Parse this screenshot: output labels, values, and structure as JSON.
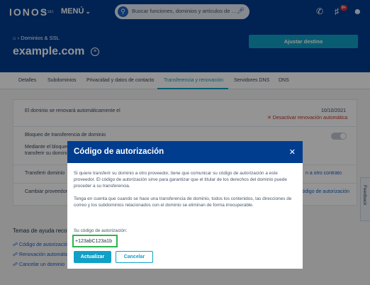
{
  "header": {
    "logo": "IONOS",
    "logo_by": "by 1&1",
    "menu_label": "MENÚ",
    "search_placeholder": "Buscar funciones, dominios y artículos de …",
    "notification_count": "9+"
  },
  "breadcrumb": {
    "section": "Dominios & SSL"
  },
  "domain": {
    "name": "example.com"
  },
  "actions": {
    "adjust_destination": "Ajustar destino"
  },
  "tabs": [
    {
      "label": "Detalles"
    },
    {
      "label": "Subdominios"
    },
    {
      "label": "Privacidad y datos de contacto"
    },
    {
      "label": "Transferencia y renovación",
      "active": true
    },
    {
      "label": "Servidores DNS"
    },
    {
      "label": "DNS"
    }
  ],
  "settings": {
    "renewal_label": "El dominio se renovará automáticamente el",
    "renewal_date": "10/10/2021",
    "deactivate_renewal": "✕ Desactivar renovación automática",
    "lock_label": "Bloqueo de transferencia de dominio",
    "lock_desc_1": "Mediante el bloqueo",
    "lock_desc_2": "transferir su domini",
    "transfer_label": "Transferir dominio",
    "transfer_link": "n a otro contrato",
    "change_label": "Cambiar proveedor",
    "change_link": "código de autorización"
  },
  "help": {
    "title": "Temas de ayuda reco",
    "links": [
      "Código de autorizació",
      "Renovación automátic",
      "Cancelar un dominio"
    ]
  },
  "feedback": "Feedback",
  "modal": {
    "title": "Código de autorización",
    "paragraph1": "Si quiere transferir su dominio a otro proveedor, tiene que comunicar su código de autorización a este proveedor. El código de autorización sirve para garantizar que el titular de los derechos del dominio puede proceder a su transferencia.",
    "paragraph2": "Tenga en cuenta que cuando se hace una transferencia de dominio, todos los contenidos, las direcciones de correo y los subdominios relacionados con el dominio se eliminan de forma irrecuperable.",
    "code_label": "Su código de autorización:",
    "code_value": "+123abC123a1b",
    "update_button": "Actualizar",
    "cancel_button": "Cancelar"
  }
}
